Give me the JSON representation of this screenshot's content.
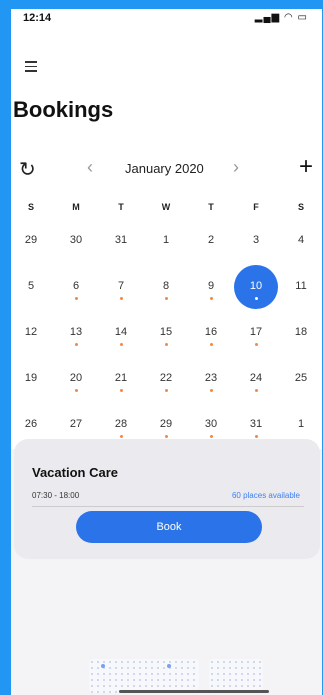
{
  "status_bar": {
    "time": "12:14",
    "icons": "signal wifi battery"
  },
  "header": {
    "title": "Bookings"
  },
  "toolbar": {
    "month": "January 2020",
    "prev": "‹",
    "next": "›",
    "add": "+",
    "refresh": "↻"
  },
  "calendar": {
    "weekdays": [
      "S",
      "M",
      "T",
      "W",
      "T",
      "F",
      "S"
    ],
    "selected_day": "10",
    "weeks": [
      [
        "29",
        "30",
        "31",
        "1",
        "2",
        "3",
        "4"
      ],
      [
        "5",
        "6",
        "7",
        "8",
        "9",
        "10",
        "11"
      ],
      [
        "12",
        "13",
        "14",
        "15",
        "16",
        "17",
        "18"
      ],
      [
        "19",
        "20",
        "21",
        "22",
        "23",
        "24",
        "25"
      ],
      [
        "26",
        "27",
        "28",
        "29",
        "30",
        "31",
        "1"
      ]
    ],
    "dots": [
      [
        false,
        false,
        false,
        false,
        false,
        false,
        false
      ],
      [
        false,
        true,
        true,
        true,
        true,
        true,
        false
      ],
      [
        false,
        true,
        true,
        true,
        true,
        true,
        false
      ],
      [
        false,
        true,
        true,
        true,
        true,
        true,
        false
      ],
      [
        false,
        false,
        true,
        true,
        true,
        true,
        false
      ]
    ]
  },
  "card": {
    "name": "Vacation Care",
    "hours": "07:30 - 18:00",
    "places": "60 places available",
    "book_label": "Book"
  },
  "colors": {
    "frame": "#2196f3",
    "accent": "#2a73e8",
    "dot": "#f08a4b",
    "link": "#3d7ff0"
  }
}
